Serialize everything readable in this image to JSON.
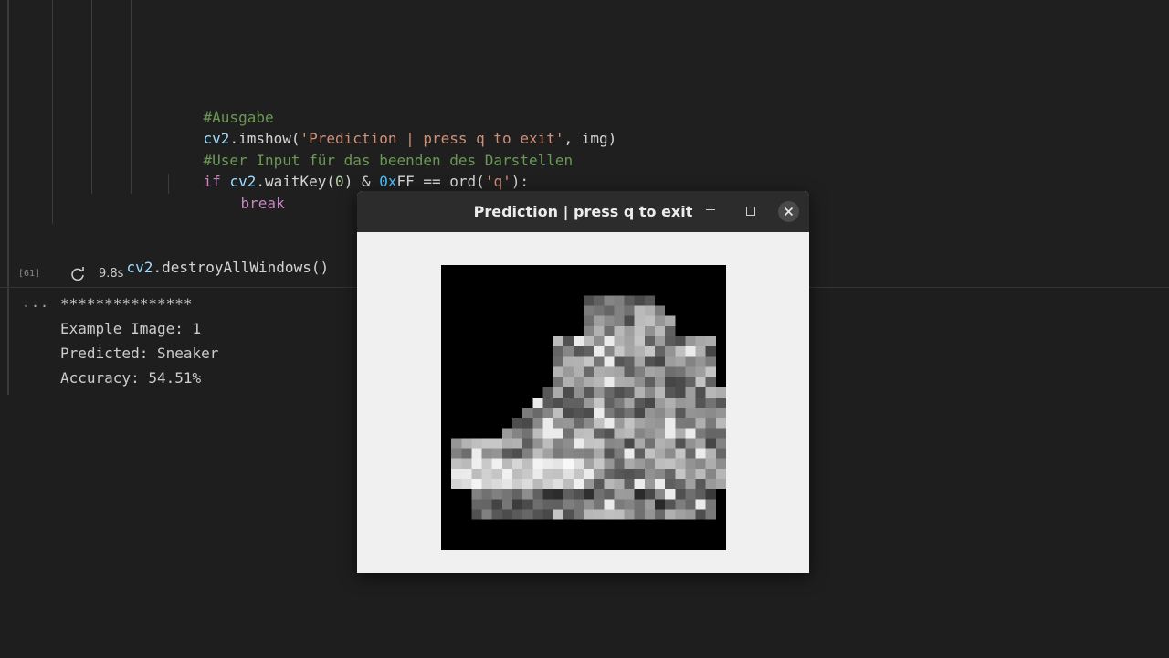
{
  "code": {
    "comment_ausgabe": "#Ausgabe",
    "imshow_obj": "cv2",
    "imshow_fn": ".imshow(",
    "imshow_str": "'Prediction | press q to exit'",
    "imshow_rest": ", img)",
    "comment_user_input": "#User Input für das beenden des Darstellen",
    "if_kw": "if",
    "waitkey_obj": "cv2",
    "waitkey_fn": ".waitKey(",
    "waitkey_arg": "0",
    "waitkey_mid": ") & ",
    "hex_prefix": "0x",
    "hex_val": "FF",
    "eq_ord": " == ord(",
    "q_str": "'q'",
    "colon": "):",
    "break_kw": "break",
    "destroy_obj": "cv2",
    "destroy_fn": ".destroyAllWindows()"
  },
  "cell_status": {
    "execution_count": "[61]",
    "duration": "9.8s",
    "icon": "refresh-icon"
  },
  "output": {
    "more_label": "...",
    "lines": [
      "***************",
      "Example Image: 1",
      "Predicted: Sneaker",
      "Accuracy: 54.51%"
    ]
  },
  "window": {
    "title": "Prediction | press q to exit",
    "buttons": [
      "minimize-icon",
      "maximize-icon",
      "close-icon"
    ],
    "image_subject": "sneaker",
    "title_bar_color": "#2c2c2c",
    "body_color": "#f0f0f0"
  }
}
